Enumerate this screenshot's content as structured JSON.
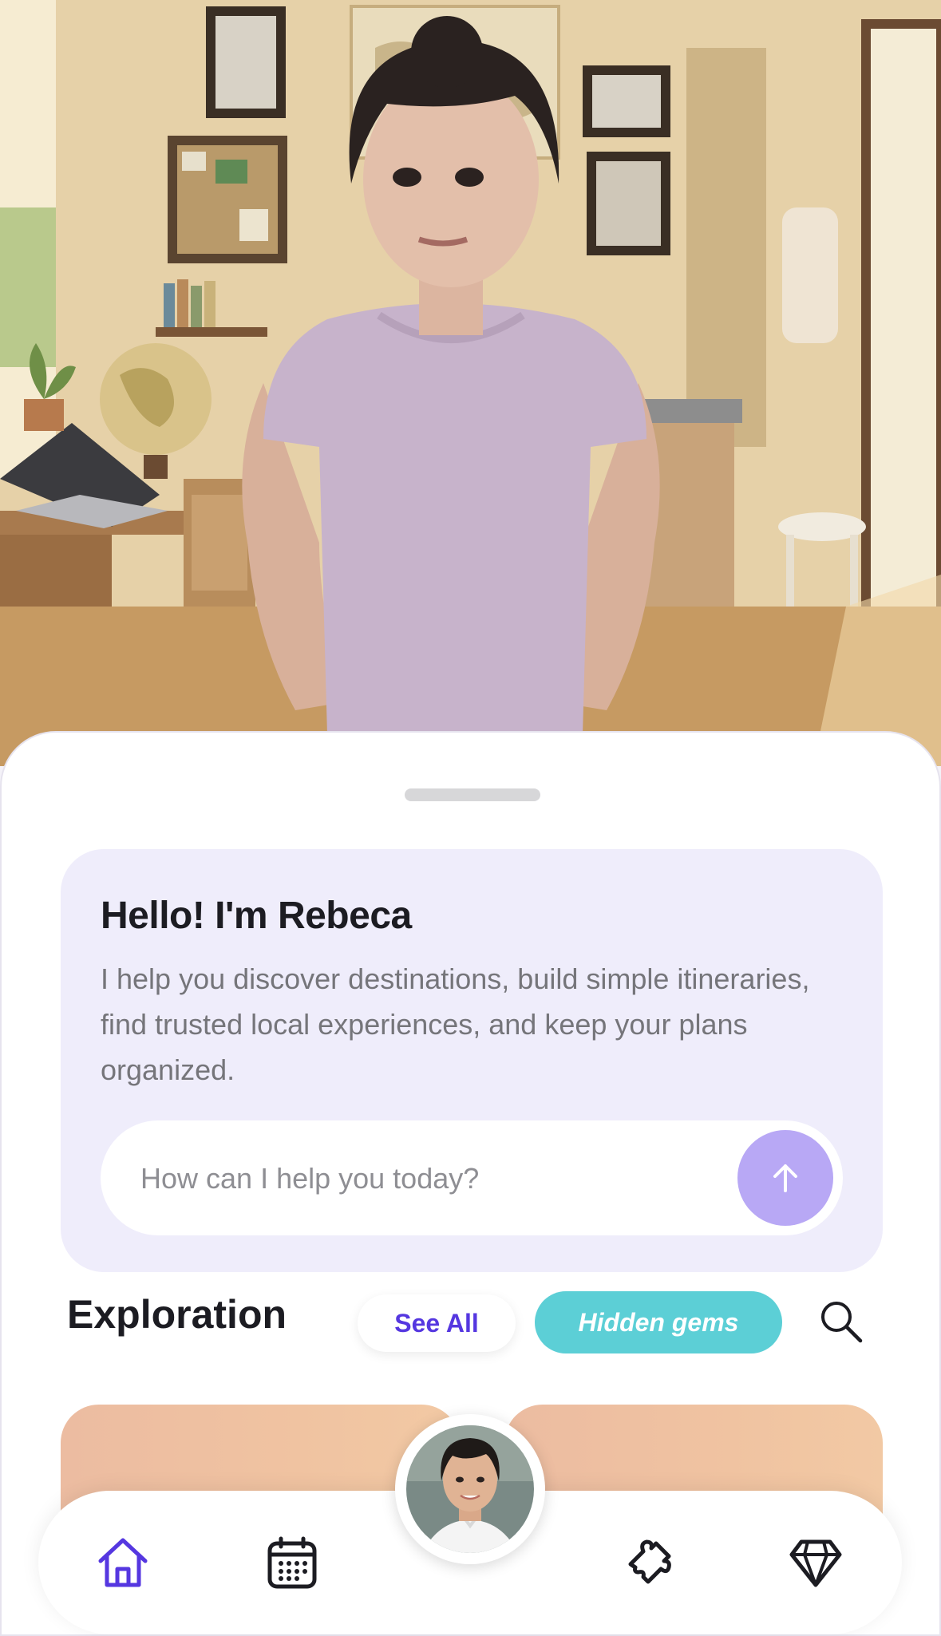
{
  "intro": {
    "title": "Hello! I'm Rebeca",
    "text": "I help you discover destinations, build simple itineraries, find trusted local experiences, and keep your plans organized."
  },
  "ask": {
    "placeholder": "How can I help you today?"
  },
  "exploration": {
    "title": "Exploration",
    "see_all": "See All",
    "hidden_gems": "Hidden gems"
  },
  "icons": {
    "send": "arrow-up-icon",
    "search": "search-icon",
    "home": "home-icon",
    "calendar": "calendar-icon",
    "puzzle": "puzzle-icon",
    "diamond": "diamond-icon"
  },
  "colors": {
    "accent": "#5537e0",
    "send_button": "#b8a8f5",
    "hidden_gems": "#5ccfd6",
    "intro_card": "#efedfb"
  }
}
